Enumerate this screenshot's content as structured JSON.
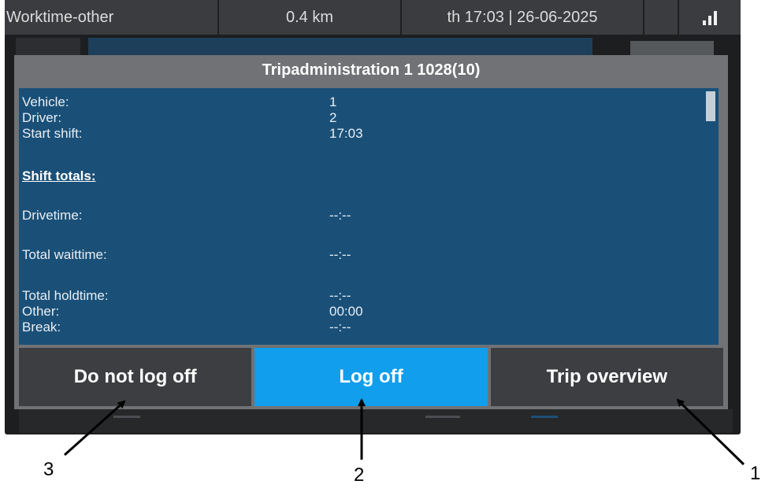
{
  "statusbar": {
    "mode": "Worktime-other",
    "distance": "0.4 km",
    "datetime": "th 17:03 | 26-06-2025",
    "signal_icon": "signal-bars-icon"
  },
  "dialog": {
    "title": "Tripadministration 1 1028(10)",
    "rows": {
      "vehicle": {
        "label": "Vehicle:",
        "value": "1"
      },
      "driver": {
        "label": "Driver:",
        "value": "2"
      },
      "start_shift": {
        "label": "Start shift:",
        "value": "17:03"
      },
      "shift_totals": "Shift totals:",
      "drivetime": {
        "label": "Drivetime:",
        "value": "--:--"
      },
      "total_waittime": {
        "label": "Total waittime:",
        "value": "--:--"
      },
      "total_holdtime": {
        "label": "Total holdtime:",
        "value": "--:--"
      },
      "other": {
        "label": "Other:",
        "value": "00:00"
      },
      "break": {
        "label": "Break:",
        "value": "--:--"
      }
    },
    "buttons": {
      "do_not_log_off": "Do not log off",
      "log_off": "Log off",
      "trip_overview": "Trip overview"
    }
  },
  "callouts": {
    "one": "1",
    "two": "2",
    "three": "3"
  },
  "colors": {
    "accent": "#109eed",
    "panel": "#1a5078",
    "header": "#707275"
  }
}
